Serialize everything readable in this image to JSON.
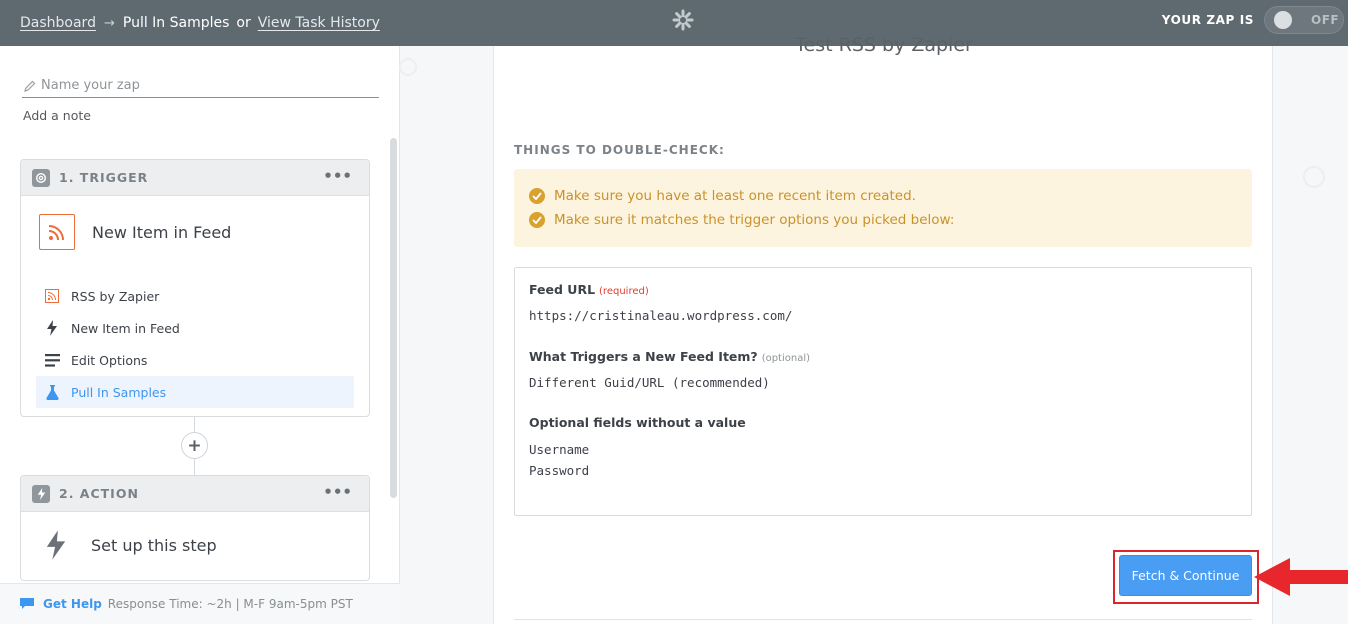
{
  "topbar": {
    "dashboard_link": "Dashboard",
    "arrow": "→",
    "current_page": "Pull In Samples",
    "or_text": "or",
    "history_link": "View Task History",
    "zap_status_label": "YOUR ZAP IS",
    "toggle_label": "OFF"
  },
  "sidebar": {
    "zap_name_placeholder": "Name your zap",
    "add_note": "Add a note",
    "trigger": {
      "header": "1. TRIGGER",
      "menu": "•••",
      "app_title": "New Item in Feed",
      "substeps": [
        {
          "label": "RSS by Zapier",
          "icon": "rss-icon"
        },
        {
          "label": "New Item in Feed",
          "icon": "bolt-icon"
        },
        {
          "label": "Edit Options",
          "icon": "lines-icon"
        },
        {
          "label": "Pull In Samples",
          "icon": "flask-icon",
          "active": true
        }
      ]
    },
    "add_step": "+",
    "action": {
      "header": "2. ACTION",
      "menu": "•••",
      "app_title": "Set up this step"
    },
    "help": {
      "label": "Get Help",
      "response": "Response Time: ~2h | M-F 9am-5pm PST"
    }
  },
  "main": {
    "title": "Test RSS by Zapier",
    "double_check_heading": "THINGS TO DOUBLE-CHECK:",
    "checks": [
      "Make sure you have at least one recent item created.",
      "Make sure it matches the trigger options you picked below:"
    ],
    "fields": {
      "feed_url_label": "Feed URL",
      "feed_url_required": "(required)",
      "feed_url_value": "https://cristinaleau.wordpress.com/",
      "trigger_label": "What Triggers a New Feed Item?",
      "trigger_optional": "(optional)",
      "trigger_value": "Different Guid/URL (recommended)",
      "optional_heading": "Optional fields without a value",
      "optional_fields": [
        "Username",
        "Password"
      ]
    },
    "fetch_button": "Fetch & Continue"
  },
  "colors": {
    "topbar": "#5f6a70",
    "accent_blue": "#499df3",
    "rss_orange": "#ee6b3a",
    "warning_bg": "#fdf4e0",
    "warning_text": "#c9922a",
    "required_red": "#e33d2b",
    "highlight_red": "#d8262c"
  }
}
